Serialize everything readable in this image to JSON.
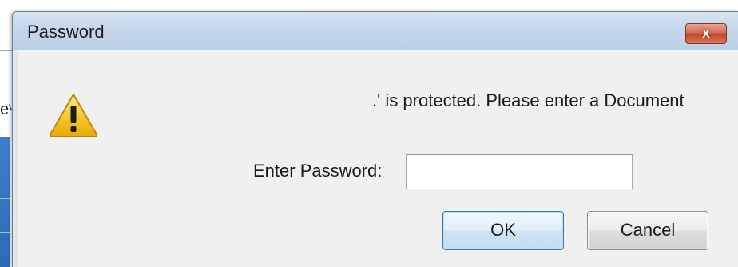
{
  "background_window": {
    "partial_text": "eᵛ"
  },
  "dialog": {
    "title": "Password",
    "close_label": "x",
    "message": ".' is protected. Please enter a Document",
    "password_label": "Enter Password:",
    "password_value": "",
    "ok_label": "OK",
    "cancel_label": "Cancel",
    "icon": "warning-icon"
  },
  "colors": {
    "titlebar": "#c4d6ea",
    "content_bg": "#f0f0f0",
    "close_button": "#c4442a",
    "ok_border": "#3d7bad",
    "warning_yellow": "#f2c21b"
  }
}
